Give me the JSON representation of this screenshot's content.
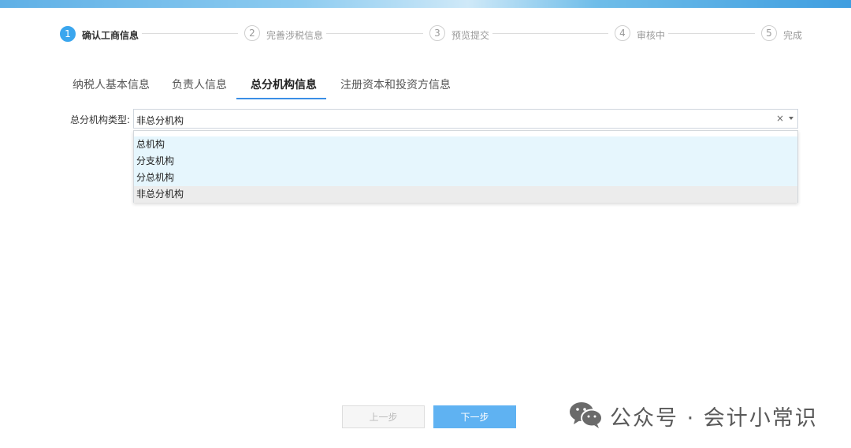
{
  "steps": [
    {
      "num": "1",
      "label": "确认工商信息",
      "active": true
    },
    {
      "num": "2",
      "label": "完善涉税信息",
      "active": false
    },
    {
      "num": "3",
      "label": "预览提交",
      "active": false
    },
    {
      "num": "4",
      "label": "审核中",
      "active": false
    },
    {
      "num": "5",
      "label": "完成",
      "active": false
    }
  ],
  "tabs": [
    {
      "label": "纳税人基本信息"
    },
    {
      "label": "负责人信息"
    },
    {
      "label": "总分机构信息"
    },
    {
      "label": "注册资本和投资方信息"
    }
  ],
  "active_tab": "总分机构信息",
  "form": {
    "org_type_label": "总分机构类型:",
    "org_type_value": "非总分机构",
    "clear_symbol": "×",
    "options": [
      "总机构",
      "分支机构",
      "分总机构",
      "非总分机构"
    ]
  },
  "buttons": {
    "prev": "上一步",
    "next": "下一步"
  },
  "watermark": {
    "text": "公众号 · 会计小常识",
    "icon": "wechat-icon"
  },
  "colors": {
    "accent": "#3aa6ee",
    "next_button": "#5fb2f2",
    "option_highlight": "#e6f6fd",
    "selected_option": "#ececec"
  }
}
